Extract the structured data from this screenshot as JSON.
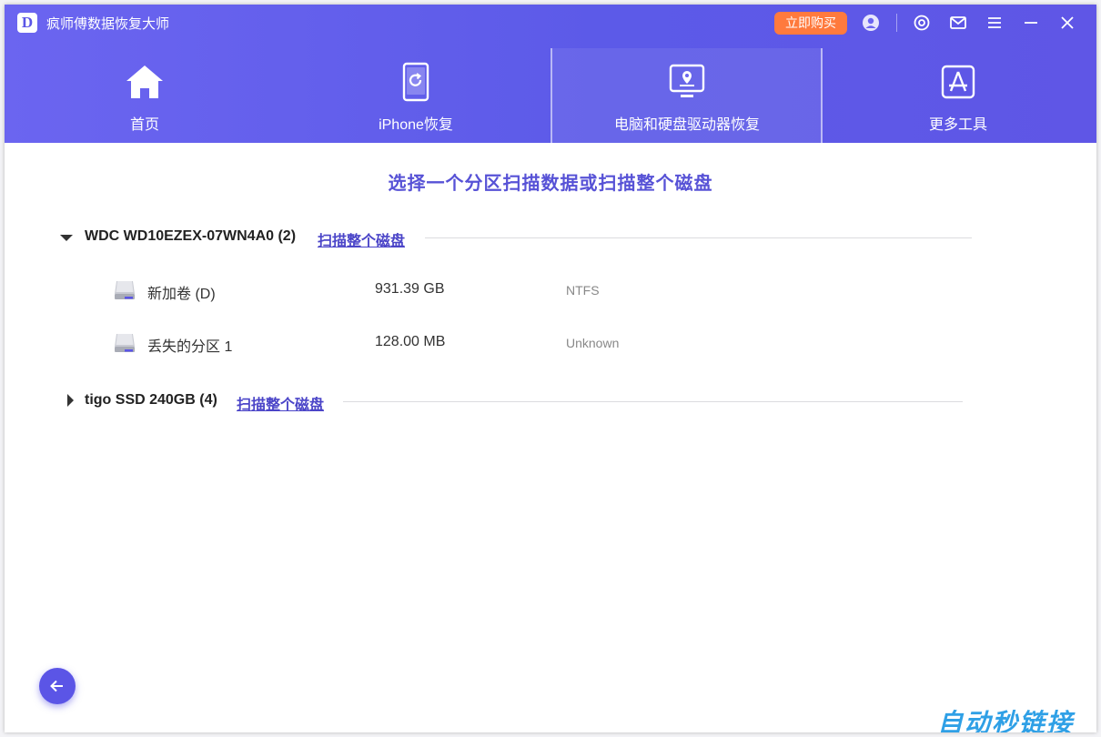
{
  "app": {
    "logo_letter": "D",
    "title": "疯师傅数据恢复大师"
  },
  "titlebar": {
    "buy_label": "立即购买",
    "icons": [
      "account-icon",
      "feedback-icon",
      "mail-icon",
      "menu-icon",
      "minimize-icon",
      "close-icon"
    ]
  },
  "nav": {
    "tabs": [
      {
        "label": "首页",
        "icon": "home-icon"
      },
      {
        "label": "iPhone恢复",
        "icon": "phone-restore-icon"
      },
      {
        "label": "电脑和硬盘驱动器恢复",
        "icon": "computer-location-icon",
        "active": true
      },
      {
        "label": "更多工具",
        "icon": "app-store-icon"
      }
    ]
  },
  "main": {
    "heading": "选择一个分区扫描数据或扫描整个磁盘",
    "disks": [
      {
        "name": "WDC WD10EZEX-07WN4A0 (2)",
        "scan_label": "扫描整个磁盘",
        "expanded": true,
        "partitions": [
          {
            "name": "新加卷 (D)",
            "size": "931.39 GB",
            "fs": "NTFS"
          },
          {
            "name": "丢失的分区 1",
            "size": "128.00 MB",
            "fs": "Unknown"
          }
        ]
      },
      {
        "name": "tigo SSD 240GB (4)",
        "scan_label": "扫描整个磁盘",
        "expanded": false
      }
    ]
  },
  "watermark": "自动秒链接",
  "colors": {
    "accent": "#5b55e6",
    "buy": "#ff7a3d",
    "heading": "#5752d6",
    "link": "#4b45c8"
  }
}
